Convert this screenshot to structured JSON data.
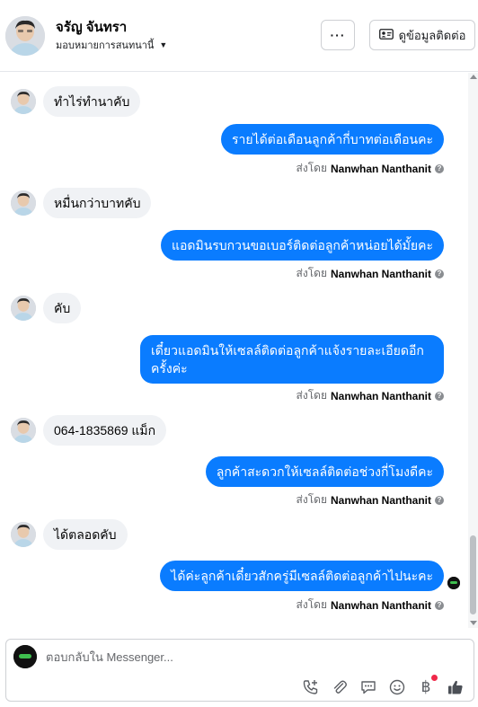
{
  "header": {
    "contact_name": "จรัญ จันทรา",
    "assign_label": "มอบหมายการสนทนานี้",
    "more_label": "···",
    "view_contact_label": "ดูข้อมูลติดต่อ"
  },
  "messages": [
    {
      "dir": "in",
      "text": "ทำไร่ทำนาคับ"
    },
    {
      "dir": "out",
      "text": "รายได้ต่อเดือนลูกค้ากี่บาทต่อเดือนคะ",
      "sent_by_prefix": "ส่งโดย",
      "sender": "Nanwhan Nanthanit"
    },
    {
      "dir": "in",
      "text": "หมื่นกว่าบาทคับ"
    },
    {
      "dir": "out",
      "text": "แอดมินรบกวนขอเบอร์ติดต่อลูกค้าหน่อยได้มั้ยคะ",
      "sent_by_prefix": "ส่งโดย",
      "sender": "Nanwhan Nanthanit"
    },
    {
      "dir": "in",
      "text": "คับ"
    },
    {
      "dir": "out",
      "text": "เดี๋ยวแอดมินให้เซลล์ติดต่อลูกค้าแจ้งรายละเอียดอีกครั้งค่ะ",
      "sent_by_prefix": "ส่งโดย",
      "sender": "Nanwhan Nanthanit"
    },
    {
      "dir": "in",
      "text": "064-1835869 แม็ก"
    },
    {
      "dir": "out",
      "text": "ลูกค้าสะดวกให้เซลล์ติดต่อช่วงกี่โมงดีคะ",
      "sent_by_prefix": "ส่งโดย",
      "sender": "Nanwhan Nanthanit"
    },
    {
      "dir": "in",
      "text": "ได้ตลอดคับ"
    },
    {
      "dir": "out",
      "text": "ได้ค่ะลูกค้าเดี๋ยวสักครู่มีเซลล์ติดต่อลูกค้าไปนะคะ",
      "sent_by_prefix": "ส่งโดย",
      "sender": "Nanwhan Nanthanit"
    }
  ],
  "composer": {
    "placeholder": "ตอบกลับใน Messenger..."
  },
  "colors": {
    "outgoing_bubble": "#0a7cff",
    "incoming_bubble": "#f0f2f5",
    "notification_dot": "#f02849"
  },
  "icons": [
    "more-icon",
    "contact-card-icon",
    "add-call-icon",
    "attach-icon",
    "saved-reply-icon",
    "emoji-icon",
    "baht-icon",
    "thumbs-up-icon",
    "info-icon",
    "caret-down-icon"
  ]
}
